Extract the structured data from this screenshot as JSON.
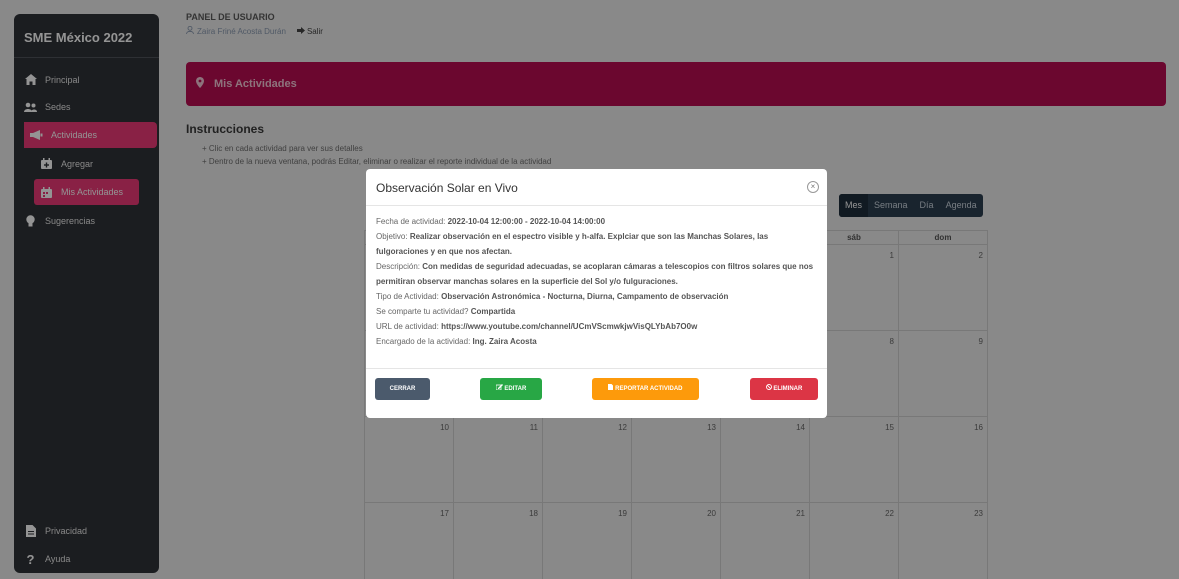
{
  "sidebar": {
    "brand": "SME México 2022",
    "items": [
      {
        "label": "Principal",
        "icon": "home-icon"
      },
      {
        "label": "Sedes",
        "icon": "users-icon"
      },
      {
        "label": "Actividades",
        "icon": "bullhorn-icon"
      },
      {
        "label": "Agregar",
        "icon": "calendar-plus-icon"
      },
      {
        "label": "Mis Actividades",
        "icon": "calendar-icon"
      },
      {
        "label": "Sugerencias",
        "icon": "lightbulb-icon"
      }
    ],
    "bottom": [
      {
        "label": "Privacidad",
        "icon": "file-icon"
      },
      {
        "label": "Ayuda",
        "icon": "question-icon"
      }
    ]
  },
  "header": {
    "title": "PANEL DE USUARIO",
    "user": "Zaira Friné Acosta Durán",
    "logout": "Salir"
  },
  "banner": {
    "title": "Mis Actividades"
  },
  "instructions": {
    "title": "Instrucciones",
    "lines": [
      "+ Clic en cada actividad para ver sus detalles",
      "+ Dentro de la nueva ventana, podrás Editar, eliminar o realizar el reporte individual de la actividad"
    ]
  },
  "calendar": {
    "views": [
      "Mes",
      "Semana",
      "Día",
      "Agenda"
    ],
    "selected_view": "Mes",
    "headers": [
      "",
      "",
      "",
      "",
      "",
      "sáb",
      "dom"
    ],
    "rows": [
      [
        "",
        "",
        "",
        "",
        "",
        "1",
        "2"
      ],
      [
        "",
        "",
        "",
        "",
        "",
        "8",
        "9"
      ],
      [
        "10",
        "11",
        "12",
        "13",
        "14",
        "15",
        "16"
      ],
      [
        "17",
        "18",
        "19",
        "20",
        "21",
        "22",
        "23"
      ]
    ]
  },
  "modal": {
    "title": "Observación Solar en Vivo",
    "fields": {
      "fecha_label": "Fecha de actividad:",
      "fecha_value": "2022-10-04 12:00:00 - 2022-10-04 14:00:00",
      "objetivo_label": "Objetivo:",
      "objetivo_value": "Realizar observación en el espectro visible y h-alfa. Explciar que son las Manchas Solares, las fulgoraciones y en que nos afectan.",
      "descripcion_label": "Descripción:",
      "descripcion_value": "Con medidas de seguridad adecuadas, se acoplaran cámaras a telescopios con filtros solares que nos permitiran observar manchas solares en la superficie del Sol y/o fulguraciones.",
      "tipo_label": "Tipo de Actividad:",
      "tipo_value": "Observación Astronómica - Nocturna, Diurna, Campamento de observación",
      "compartida_label": "Se comparte tu actividad?",
      "compartida_value": "Compartida",
      "url_label": "URL de actividad:",
      "url_value": "https://www.youtube.com/channel/UCmVScmwkjwVisQLYbAb7O0w",
      "encargado_label": "Encargado de la actividad:",
      "encargado_value": "Ing. Zaira Acosta"
    },
    "buttons": {
      "close": "CERRAR",
      "edit": "EDITAR",
      "report": "REPORTAR ACTIVIDAD",
      "delete": "ELIMINAR"
    }
  },
  "colors": {
    "accent": "#ec3a77",
    "banner": "#b80d52",
    "sidebar": "#2f3237"
  }
}
